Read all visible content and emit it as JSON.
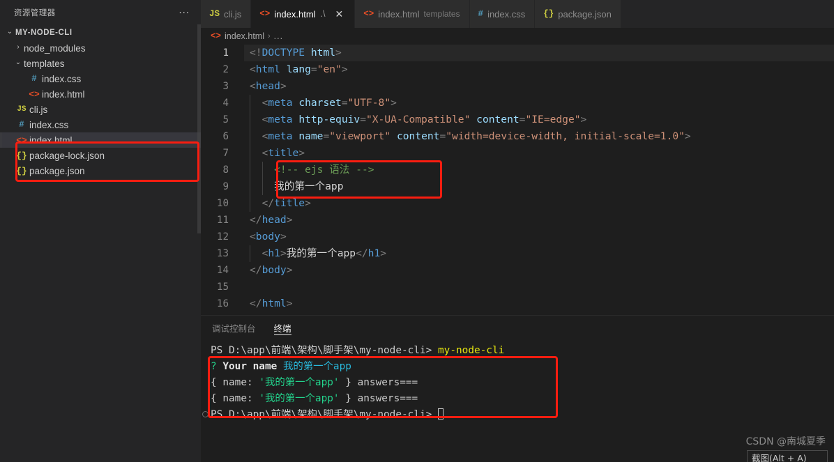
{
  "sidebar": {
    "header_title": "资源管理器",
    "more_actions": "...",
    "tree": [
      {
        "label": "MY-NODE-CLI",
        "chevron": "⌄",
        "icon": "",
        "icon_class": "",
        "indent": 6,
        "type": "root",
        "selected": false
      },
      {
        "label": "node_modules",
        "chevron": "›",
        "icon": "",
        "icon_class": "",
        "indent": 18,
        "type": "folder",
        "selected": false
      },
      {
        "label": "templates",
        "chevron": "⌄",
        "icon": "",
        "icon_class": "",
        "indent": 18,
        "type": "folder",
        "selected": false
      },
      {
        "label": "index.css",
        "chevron": "",
        "icon": "#",
        "icon_class": "ic-css",
        "indent": 38,
        "type": "file",
        "selected": false
      },
      {
        "label": "index.html",
        "chevron": "",
        "icon": "<>",
        "icon_class": "ic-html",
        "indent": 38,
        "type": "file",
        "selected": false
      },
      {
        "label": "cli.js",
        "chevron": "",
        "icon": "JS",
        "icon_class": "ic-js",
        "indent": 20,
        "type": "file",
        "selected": false
      },
      {
        "label": "index.css",
        "chevron": "",
        "icon": "#",
        "icon_class": "ic-css",
        "indent": 20,
        "type": "file",
        "selected": false
      },
      {
        "label": "index.html",
        "chevron": "",
        "icon": "<>",
        "icon_class": "ic-html",
        "indent": 20,
        "type": "file",
        "selected": true
      },
      {
        "label": "package-lock.json",
        "chevron": "",
        "icon": "{}",
        "icon_class": "ic-json",
        "indent": 20,
        "type": "file",
        "selected": false
      },
      {
        "label": "package.json",
        "chevron": "",
        "icon": "{}",
        "icon_class": "ic-json",
        "indent": 20,
        "type": "file",
        "selected": false
      }
    ]
  },
  "tabs": [
    {
      "icon": "JS",
      "icon_class": "ic-js",
      "label": "cli.js",
      "desc": "",
      "path": "",
      "active": false,
      "closable": false
    },
    {
      "icon": "<>",
      "icon_class": "ic-html",
      "label": "index.html",
      "desc": "",
      "path": ".\\",
      "active": true,
      "closable": true
    },
    {
      "icon": "<>",
      "icon_class": "ic-html",
      "label": "index.html",
      "desc": "templates",
      "path": "",
      "active": false,
      "closable": false
    },
    {
      "icon": "#",
      "icon_class": "ic-css",
      "label": "index.css",
      "desc": "",
      "path": "",
      "active": false,
      "closable": false
    },
    {
      "icon": "{}",
      "icon_class": "ic-json",
      "label": "package.json",
      "desc": "",
      "path": "",
      "active": false,
      "closable": false
    }
  ],
  "breadcrumb": {
    "icon": "<>",
    "file": "index.html",
    "separator": "›",
    "overflow": "..."
  },
  "editor": {
    "close_icon": "✕",
    "lines": [
      {
        "n": "1",
        "guides": 0,
        "current": true,
        "tokens": [
          {
            "t": "&lt;!",
            "c": "t-punc"
          },
          {
            "t": "DOCTYPE",
            "c": "t-doctype"
          },
          {
            "t": " ",
            "c": "t-txt"
          },
          {
            "t": "html",
            "c": "t-dt-name"
          },
          {
            "t": "&gt;",
            "c": "t-punc"
          }
        ]
      },
      {
        "n": "2",
        "guides": 0,
        "current": false,
        "tokens": [
          {
            "t": "&lt;",
            "c": "t-punc"
          },
          {
            "t": "html",
            "c": "t-tag"
          },
          {
            "t": " ",
            "c": "t-txt"
          },
          {
            "t": "lang",
            "c": "t-attr"
          },
          {
            "t": "=",
            "c": "t-punc"
          },
          {
            "t": "\"en\"",
            "c": "t-str"
          },
          {
            "t": "&gt;",
            "c": "t-punc"
          }
        ]
      },
      {
        "n": "3",
        "guides": 0,
        "current": false,
        "tokens": [
          {
            "t": "&lt;",
            "c": "t-punc"
          },
          {
            "t": "head",
            "c": "t-tag"
          },
          {
            "t": "&gt;",
            "c": "t-punc"
          }
        ]
      },
      {
        "n": "4",
        "guides": 1,
        "current": false,
        "tokens": [
          {
            "t": "  &lt;",
            "c": "t-punc"
          },
          {
            "t": "meta",
            "c": "t-tag"
          },
          {
            "t": " ",
            "c": "t-txt"
          },
          {
            "t": "charset",
            "c": "t-attr"
          },
          {
            "t": "=",
            "c": "t-punc"
          },
          {
            "t": "\"UTF-8\"",
            "c": "t-str"
          },
          {
            "t": "&gt;",
            "c": "t-punc"
          }
        ]
      },
      {
        "n": "5",
        "guides": 1,
        "current": false,
        "tokens": [
          {
            "t": "  &lt;",
            "c": "t-punc"
          },
          {
            "t": "meta",
            "c": "t-tag"
          },
          {
            "t": " ",
            "c": "t-txt"
          },
          {
            "t": "http-equiv",
            "c": "t-attr"
          },
          {
            "t": "=",
            "c": "t-punc"
          },
          {
            "t": "\"X-UA-Compatible\"",
            "c": "t-str"
          },
          {
            "t": " ",
            "c": "t-txt"
          },
          {
            "t": "content",
            "c": "t-attr"
          },
          {
            "t": "=",
            "c": "t-punc"
          },
          {
            "t": "\"IE=edge\"",
            "c": "t-str"
          },
          {
            "t": "&gt;",
            "c": "t-punc"
          }
        ]
      },
      {
        "n": "6",
        "guides": 1,
        "current": false,
        "tokens": [
          {
            "t": "  &lt;",
            "c": "t-punc"
          },
          {
            "t": "meta",
            "c": "t-tag"
          },
          {
            "t": " ",
            "c": "t-txt"
          },
          {
            "t": "name",
            "c": "t-attr"
          },
          {
            "t": "=",
            "c": "t-punc"
          },
          {
            "t": "\"viewport\"",
            "c": "t-str"
          },
          {
            "t": " ",
            "c": "t-txt"
          },
          {
            "t": "content",
            "c": "t-attr"
          },
          {
            "t": "=",
            "c": "t-punc"
          },
          {
            "t": "\"width=device-width, initial-scale=1.0\"",
            "c": "t-str"
          },
          {
            "t": "&gt;",
            "c": "t-punc"
          }
        ]
      },
      {
        "n": "7",
        "guides": 1,
        "current": false,
        "tokens": [
          {
            "t": "  &lt;",
            "c": "t-punc"
          },
          {
            "t": "title",
            "c": "t-tag"
          },
          {
            "t": "&gt;",
            "c": "t-punc"
          }
        ]
      },
      {
        "n": "8",
        "guides": 2,
        "current": false,
        "tokens": [
          {
            "t": "    &lt;!-- ejs ",
            "c": "t-cmt"
          },
          {
            "t": "语法",
            "c": "t-cmt cjk"
          },
          {
            "t": " --&gt;",
            "c": "t-cmt"
          }
        ]
      },
      {
        "n": "9",
        "guides": 2,
        "current": false,
        "tokens": [
          {
            "t": "    ",
            "c": "t-txt"
          },
          {
            "t": "我的第一个",
            "c": "t-txt cjk"
          },
          {
            "t": "app",
            "c": "t-txt"
          }
        ]
      },
      {
        "n": "10",
        "guides": 1,
        "current": false,
        "tokens": [
          {
            "t": "  &lt;/",
            "c": "t-punc"
          },
          {
            "t": "title",
            "c": "t-tag"
          },
          {
            "t": "&gt;",
            "c": "t-punc"
          }
        ]
      },
      {
        "n": "11",
        "guides": 0,
        "current": false,
        "tokens": [
          {
            "t": "&lt;/",
            "c": "t-punc"
          },
          {
            "t": "head",
            "c": "t-tag"
          },
          {
            "t": "&gt;",
            "c": "t-punc"
          }
        ]
      },
      {
        "n": "12",
        "guides": 0,
        "current": false,
        "tokens": [
          {
            "t": "&lt;",
            "c": "t-punc"
          },
          {
            "t": "body",
            "c": "t-tag"
          },
          {
            "t": "&gt;",
            "c": "t-punc"
          }
        ]
      },
      {
        "n": "13",
        "guides": 1,
        "current": false,
        "tokens": [
          {
            "t": "  &lt;",
            "c": "t-punc"
          },
          {
            "t": "h1",
            "c": "t-tag"
          },
          {
            "t": "&gt;",
            "c": "t-punc"
          },
          {
            "t": "我的第一个",
            "c": "t-txt cjk"
          },
          {
            "t": "app",
            "c": "t-txt"
          },
          {
            "t": "&lt;/",
            "c": "t-punc"
          },
          {
            "t": "h1",
            "c": "t-tag"
          },
          {
            "t": "&gt;",
            "c": "t-punc"
          }
        ]
      },
      {
        "n": "14",
        "guides": 0,
        "current": false,
        "tokens": [
          {
            "t": "&lt;/",
            "c": "t-punc"
          },
          {
            "t": "body",
            "c": "t-tag"
          },
          {
            "t": "&gt;",
            "c": "t-punc"
          }
        ]
      },
      {
        "n": "15",
        "guides": 0,
        "current": false,
        "tokens": []
      },
      {
        "n": "16",
        "guides": 0,
        "current": false,
        "tokens": [
          {
            "t": "&lt;/",
            "c": "t-punc"
          },
          {
            "t": "html",
            "c": "t-tag"
          },
          {
            "t": "&gt;",
            "c": "t-punc"
          }
        ]
      }
    ]
  },
  "panel": {
    "tabs": [
      {
        "label": "调试控制台",
        "active": false
      },
      {
        "label": "终端",
        "active": true
      }
    ],
    "terminal_lines": [
      {
        "dot": false,
        "segments": [
          {
            "t": "PS D:\\app\\前端\\架构\\脚手架\\my-node-cli> ",
            "c": "tm-white"
          },
          {
            "t": "my-node-cli",
            "c": "tm-yellow"
          }
        ]
      },
      {
        "dot": false,
        "segments": [
          {
            "t": "? ",
            "c": "tm-green"
          },
          {
            "t": "Your name ",
            "c": "tm-bold"
          },
          {
            "t": "我的第一个app",
            "c": "tm-cyan"
          }
        ]
      },
      {
        "dot": false,
        "segments": [
          {
            "t": "{ name: ",
            "c": "tm-white"
          },
          {
            "t": "'我的第一个app'",
            "c": "tm-green"
          },
          {
            "t": " } answers===",
            "c": "tm-white"
          }
        ]
      },
      {
        "dot": false,
        "segments": [
          {
            "t": "{ name: ",
            "c": "tm-white"
          },
          {
            "t": "'我的第一个app'",
            "c": "tm-green"
          },
          {
            "t": " } answers===",
            "c": "tm-white"
          }
        ]
      },
      {
        "dot": true,
        "segments": [
          {
            "t": "PS D:\\app\\前端\\架构\\脚手架\\my-node-cli> ",
            "c": "tm-white"
          }
        ],
        "caret": true
      }
    ]
  },
  "watermark": {
    "text": "CSDN @南城夏季",
    "tooltip": "截图(Alt + A)"
  },
  "colors": {
    "annotation_red": "#f91d10",
    "sidebar_bg": "#252526",
    "editor_bg": "#1e1e1e",
    "tab_inactive_bg": "#2d2d2d"
  }
}
